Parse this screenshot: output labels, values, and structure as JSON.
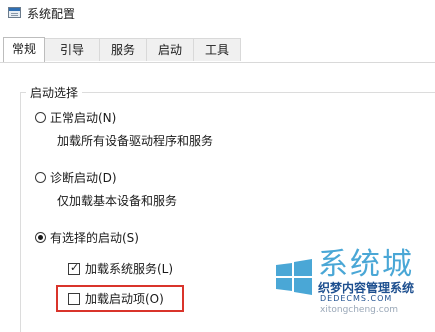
{
  "window": {
    "title": "系统配置",
    "icon": "msconfig-icon"
  },
  "tabs": [
    {
      "label": "常规",
      "active": true
    },
    {
      "label": "引导",
      "active": false
    },
    {
      "label": "服务",
      "active": false
    },
    {
      "label": "启动",
      "active": false
    },
    {
      "label": "工具",
      "active": false
    }
  ],
  "startup_selection": {
    "group_title": "启动选择",
    "options": [
      {
        "label": "正常启动(N)",
        "description": "加载所有设备驱动程序和服务",
        "selected": false
      },
      {
        "label": "诊断启动(D)",
        "description": "仅加载基本设备和服务",
        "selected": false
      },
      {
        "label": "有选择的启动(S)",
        "selected": true
      }
    ],
    "checkboxes": [
      {
        "label": "加载系统服务(L)",
        "checked": true
      },
      {
        "label": "加载启动项(O)",
        "checked": false
      }
    ]
  },
  "watermark": {
    "big_text": "系统城",
    "cn_text": "织梦内容管理系统",
    "url_text": "DEDECMS.COM",
    "url2_text": "xitongcheng.com"
  },
  "colors": {
    "highlight": "#d9342b",
    "watermark_blue": "#4aa7d6"
  }
}
